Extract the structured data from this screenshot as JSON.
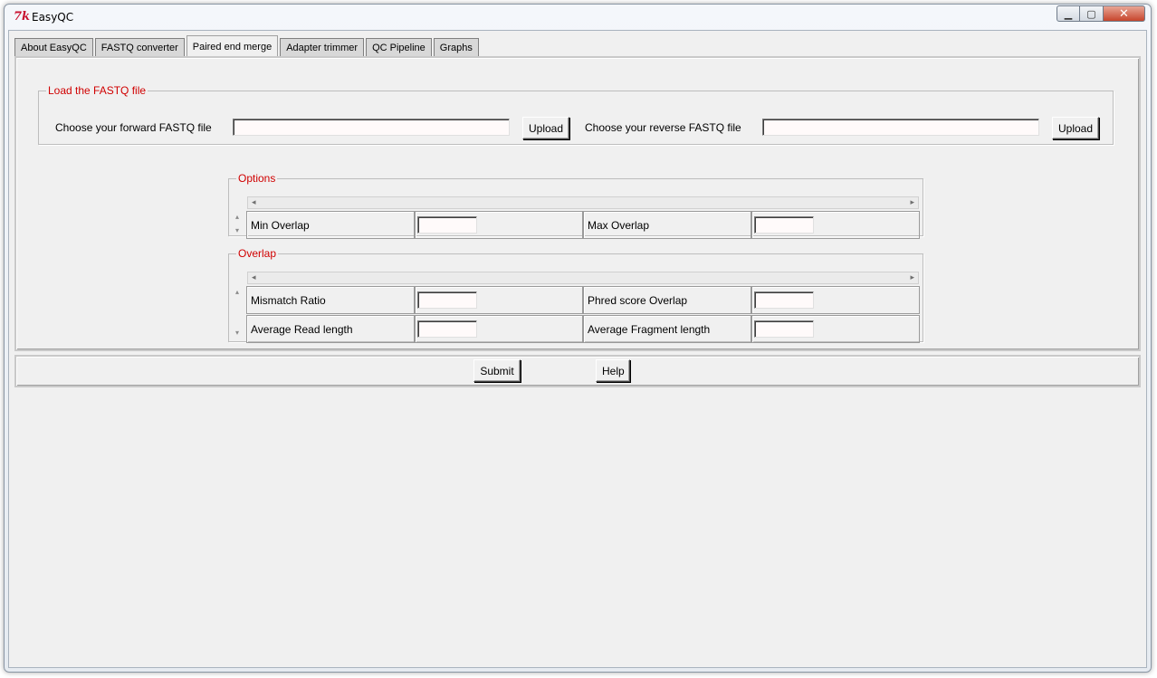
{
  "window": {
    "title": "EasyQC",
    "app_icon": "tk-feather-icon",
    "min_glyph": "▁",
    "max_glyph": "▢",
    "close_glyph": "✕"
  },
  "tabs": [
    {
      "label": "About EasyQC",
      "active": false
    },
    {
      "label": "FASTQ converter",
      "active": false
    },
    {
      "label": "Paired end merge",
      "active": true
    },
    {
      "label": "Adapter trimmer",
      "active": false
    },
    {
      "label": "QC Pipeline",
      "active": false
    },
    {
      "label": "Graphs",
      "active": false
    }
  ],
  "load_section": {
    "legend": "Load the FASTQ file",
    "forward_label": "Choose your forward FASTQ file",
    "forward_value": "",
    "forward_upload": "Upload",
    "reverse_label": "Choose your reverse FASTQ file",
    "reverse_value": "",
    "reverse_upload": "Upload"
  },
  "options_section": {
    "legend": "Options",
    "rows": [
      [
        {
          "label": "Min Overlap",
          "value": ""
        },
        {
          "label": "Max Overlap",
          "value": ""
        }
      ]
    ]
  },
  "overlap_section": {
    "legend": "Overlap",
    "rows": [
      [
        {
          "label": "Mismatch Ratio",
          "value": ""
        },
        {
          "label": "Phred score Overlap",
          "value": ""
        }
      ],
      [
        {
          "label": "Average Read length",
          "value": ""
        },
        {
          "label": "Average Fragment length",
          "value": ""
        }
      ]
    ]
  },
  "actions": {
    "submit": "Submit",
    "help": "Help"
  },
  "glyphs": {
    "left": "◂",
    "right": "▸",
    "up": "▴",
    "down": "▾"
  }
}
